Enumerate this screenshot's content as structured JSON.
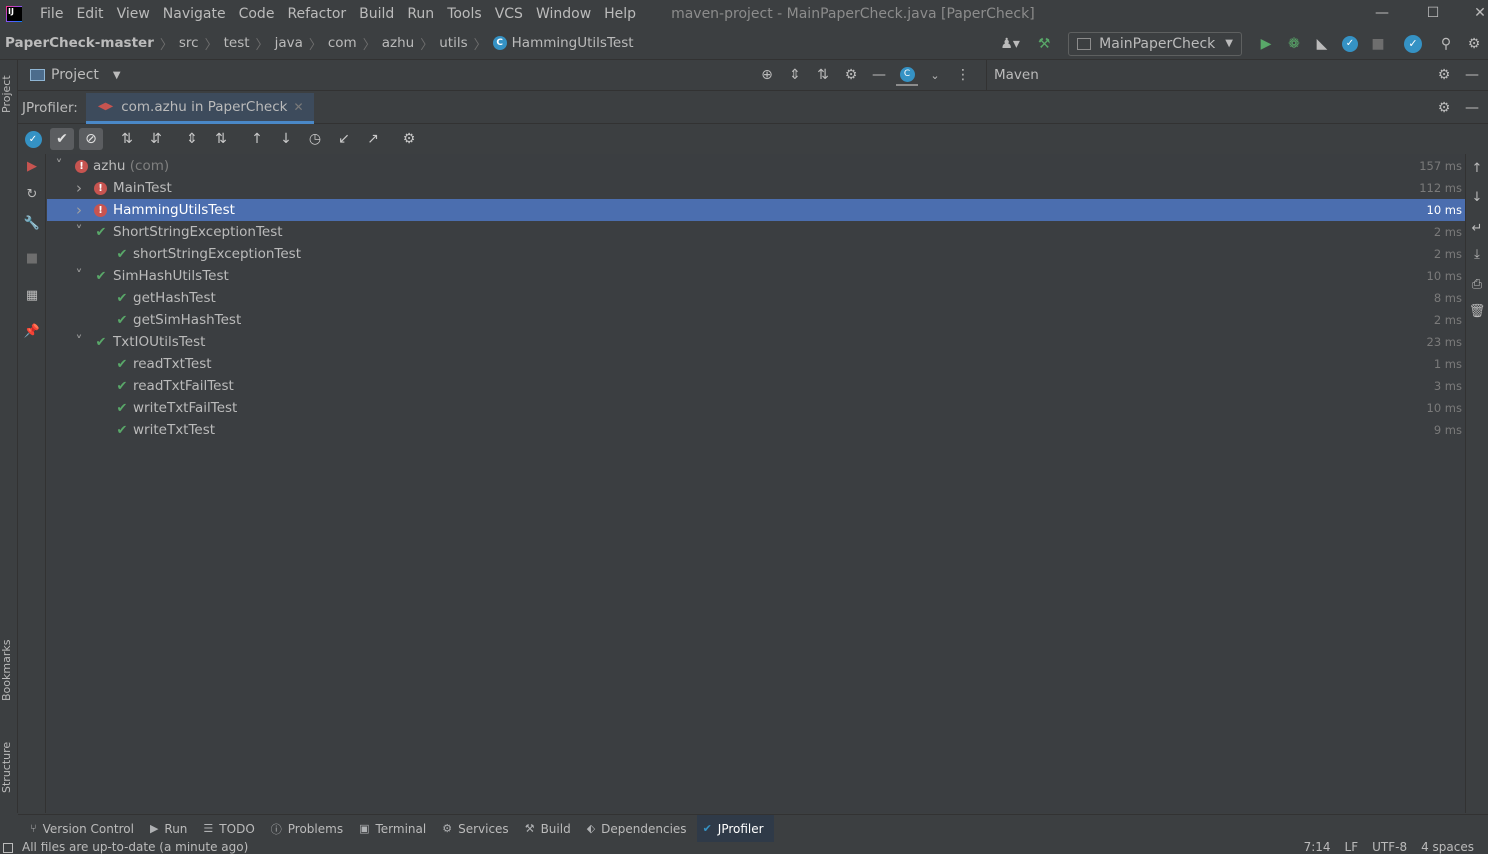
{
  "menubar": {
    "items": [
      "File",
      "Edit",
      "View",
      "Navigate",
      "Code",
      "Refactor",
      "Build",
      "Run",
      "Tools",
      "VCS",
      "Window",
      "Help"
    ],
    "window_title": "maven-project - MainPaperCheck.java [PaperCheck]"
  },
  "breadcrumb": {
    "items": [
      "PaperCheck-master",
      "src",
      "test",
      "java",
      "com",
      "azhu",
      "utils"
    ],
    "current": "HammingUtilsTest"
  },
  "toolbar": {
    "run_config": "MainPaperCheck"
  },
  "left_stripe": {
    "project": "Project",
    "bookmarks": "Bookmarks",
    "structure": "Structure"
  },
  "project_panel": {
    "title": "Project"
  },
  "maven_panel": {
    "title": "Maven"
  },
  "tool_window": {
    "label": "JProfiler:",
    "tab": "com.azhu in PaperCheck"
  },
  "test_tree": {
    "rows": [
      {
        "name": "azhu",
        "suffix": " (com)",
        "duration": "157 ms",
        "status": "fail",
        "level": 0,
        "expanded": true
      },
      {
        "name": "MainTest",
        "suffix": "",
        "duration": "112 ms",
        "status": "fail",
        "level": 1,
        "expanded": false
      },
      {
        "name": "HammingUtilsTest",
        "suffix": "",
        "duration": "10 ms",
        "status": "fail",
        "level": 1,
        "expanded": false,
        "selected": true
      },
      {
        "name": "ShortStringExceptionTest",
        "suffix": "",
        "duration": "2 ms",
        "status": "pass",
        "level": 1,
        "expanded": true
      },
      {
        "name": "shortStringExceptionTest",
        "suffix": "",
        "duration": "2 ms",
        "status": "pass",
        "level": 2
      },
      {
        "name": "SimHashUtilsTest",
        "suffix": "",
        "duration": "10 ms",
        "status": "pass",
        "level": 1,
        "expanded": true
      },
      {
        "name": "getHashTest",
        "suffix": "",
        "duration": "8 ms",
        "status": "pass",
        "level": 2
      },
      {
        "name": "getSimHashTest",
        "suffix": "",
        "duration": "2 ms",
        "status": "pass",
        "level": 2
      },
      {
        "name": "TxtIOUtilsTest",
        "suffix": "",
        "duration": "23 ms",
        "status": "pass",
        "level": 1,
        "expanded": true
      },
      {
        "name": "readTxtTest",
        "suffix": "",
        "duration": "1 ms",
        "status": "pass",
        "level": 2
      },
      {
        "name": "readTxtFailTest",
        "suffix": "",
        "duration": "3 ms",
        "status": "pass",
        "level": 2
      },
      {
        "name": "writeTxtFailTest",
        "suffix": "",
        "duration": "10 ms",
        "status": "pass",
        "level": 2
      },
      {
        "name": "writeTxtTest",
        "suffix": "",
        "duration": "9 ms",
        "status": "pass",
        "level": 2
      }
    ]
  },
  "bottom_tabs": [
    {
      "label": "Version Control",
      "icon": "branch-icon"
    },
    {
      "label": "Run",
      "icon": "run-icon"
    },
    {
      "label": "TODO",
      "icon": "list-icon"
    },
    {
      "label": "Problems",
      "icon": "problems-icon"
    },
    {
      "label": "Terminal",
      "icon": "terminal-icon"
    },
    {
      "label": "Services",
      "icon": "services-icon"
    },
    {
      "label": "Build",
      "icon": "hammer-icon"
    },
    {
      "label": "Dependencies",
      "icon": "layers-icon"
    },
    {
      "label": "JProfiler",
      "icon": "jprofiler-icon",
      "active": true
    }
  ],
  "statusbar": {
    "message": "All files are up-to-date (a minute ago)",
    "position": "7:14",
    "line_ending": "LF",
    "encoding": "UTF-8",
    "indent": "4 spaces"
  },
  "colors": {
    "selection": "#4b6eaf",
    "pass": "#59a869",
    "fail": "#c75450",
    "accent": "#3592c4"
  }
}
